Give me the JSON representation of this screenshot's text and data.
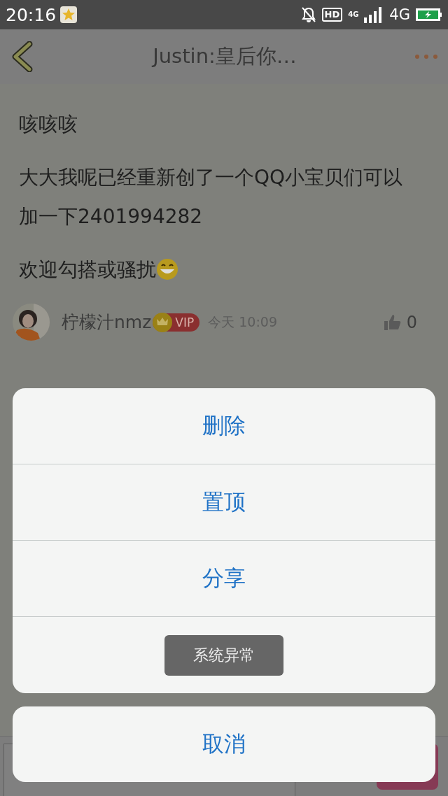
{
  "status_bar": {
    "time": "20:16",
    "hd": "HD",
    "data_type": "4G",
    "network": "4G"
  },
  "header": {
    "title": "Justin:皇后你…"
  },
  "post": {
    "paragraphs": [
      {
        "text": "咳咳咳",
        "emoji": false
      },
      {
        "text": "大大我呢已经重新创了一个QQ小宝贝们可以加一下2401994282",
        "emoji": false
      },
      {
        "text": "欢迎勾搭或骚扰",
        "emoji": true
      }
    ],
    "author": "柠檬汁nmz",
    "vip_badge": "VIP",
    "time": "今天 10:09",
    "likes": "0"
  },
  "action_sheet": {
    "actions": [
      {
        "label": "删除"
      },
      {
        "label": "置顶"
      },
      {
        "label": "分享"
      }
    ],
    "cancel": "取消"
  },
  "toast": {
    "message": "系统异常"
  }
}
